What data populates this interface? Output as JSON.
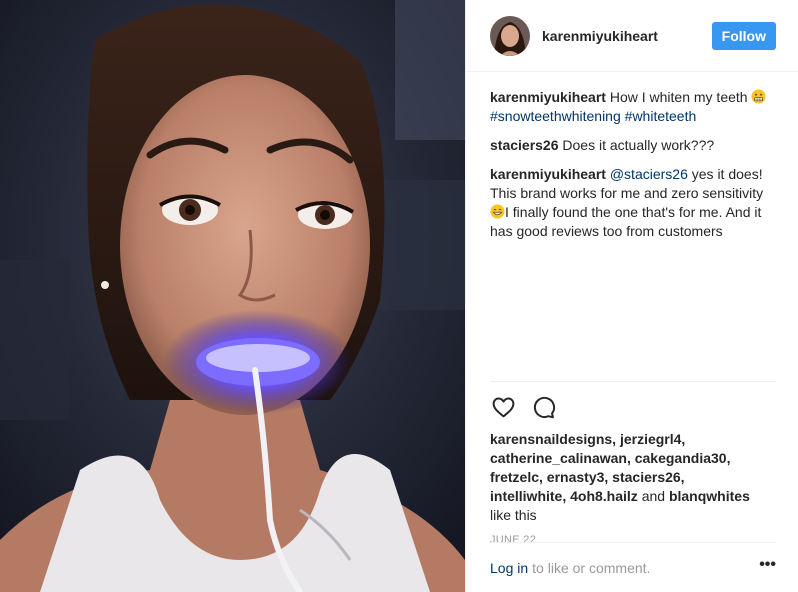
{
  "header": {
    "username": "karenmiyukiheart",
    "follow_label": "Follow"
  },
  "comments": [
    {
      "username": "karenmiyukiheart",
      "text_before_emoji": " How I whiten my teeth ",
      "emoji": "grimacing-face",
      "tags": [
        "#snowteethwhitening",
        "#whiteteeth"
      ]
    },
    {
      "username": "staciers26",
      "text": " Does it actually work???"
    },
    {
      "username": "karenmiyukiheart",
      "mention": "@staciers26",
      "text_part1": " yes it does! This brand works for me and zero sensitivity ",
      "emoji": "grinning-face",
      "text_part2": "I finally found the one that's for me. And it has good reviews too from customers"
    }
  ],
  "likes": {
    "names_line1": "karensnaildesigns, jerziegrl4,",
    "names_line2": "catherine_calinawan, cakegandia30,",
    "names_line3": "fretzelc, ernasty3, staciers26,",
    "names_line4a": "intelliwhite, 4oh8.hailz",
    "and_word": " and ",
    "names_line4b": "blanqwhites",
    "suffix": "like this"
  },
  "date": "JUNE 22",
  "login": {
    "link_label": "Log in",
    "text": "to like or comment.",
    "more_label": "•••"
  },
  "colors": {
    "accent_blue": "#3897f0",
    "link_navy": "#003569",
    "muted": "#999999",
    "glow": "#5a44ff"
  }
}
